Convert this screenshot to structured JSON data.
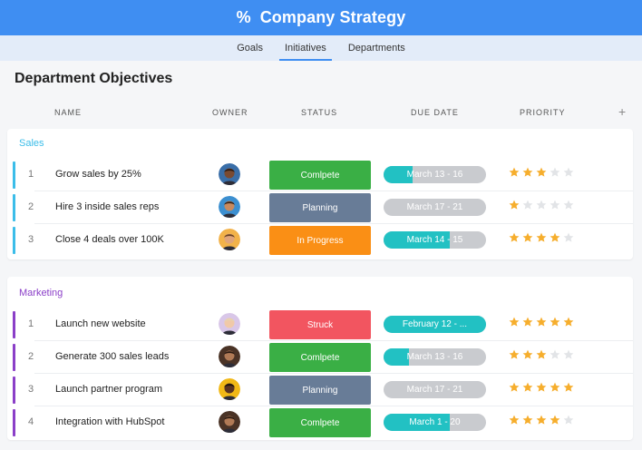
{
  "app": {
    "title": "Company Strategy",
    "logo_icon": "percent-icon"
  },
  "tabs": [
    {
      "label": "Goals",
      "active": false
    },
    {
      "label": "Initiatives",
      "active": true
    },
    {
      "label": "Departments",
      "active": false
    }
  ],
  "page": {
    "title": "Department Objectives"
  },
  "columns": {
    "name": "NAME",
    "owner": "OWNER",
    "status": "STATUS",
    "due_date": "DUE DATE",
    "priority": "PRIORITY",
    "add_icon": "plus-icon"
  },
  "colors": {
    "header": "#3f8ef2",
    "sales": "#3bbde9",
    "marketing": "#8b3fc8",
    "Comlpete": "#3aaf45",
    "Planning": "#687c97",
    "In Progress": "#fa8f15",
    "Struck": "#f25560",
    "star_on": "#f6ae2d",
    "star_off": "#e2e4e7",
    "due_fill": "#22c1c3"
  },
  "sections": [
    {
      "name": "Sales",
      "rows": [
        {
          "num": "1",
          "name": "Grow sales by 25%",
          "avatar": "avatar-man-dark",
          "status": "Comlpete",
          "due": "March 13 - 16",
          "progress": 0.28,
          "priority": 3
        },
        {
          "num": "2",
          "name": "Hire 3 inside sales reps",
          "avatar": "avatar-woman-blue",
          "status": "Planning",
          "due": "March 17 - 21",
          "progress": 0.0,
          "priority": 1
        },
        {
          "num": "3",
          "name": "Close 4 deals over 100K",
          "avatar": "avatar-man-beard",
          "status": "In Progress",
          "due": "March 14 - 15",
          "progress": 0.65,
          "priority": 4
        }
      ]
    },
    {
      "name": "Marketing",
      "rows": [
        {
          "num": "1",
          "name": "Launch new website",
          "avatar": "avatar-woman-light",
          "status": "Struck",
          "due": "February 12 - ...",
          "progress": 1.0,
          "priority": 5
        },
        {
          "num": "2",
          "name": "Generate 300 sales leads",
          "avatar": "avatar-man-glasses",
          "status": "Comlpete",
          "due": "March 13 - 16",
          "progress": 0.25,
          "priority": 3
        },
        {
          "num": "3",
          "name": "Launch partner program",
          "avatar": "avatar-man-yellow",
          "status": "Planning",
          "due": "March 17 - 21",
          "progress": 0.0,
          "priority": 5
        },
        {
          "num": "4",
          "name": "Integration with HubSpot",
          "avatar": "avatar-man-glasses",
          "status": "Comlpete",
          "due": "March 1 - 20",
          "progress": 0.65,
          "priority": 4
        }
      ]
    }
  ]
}
